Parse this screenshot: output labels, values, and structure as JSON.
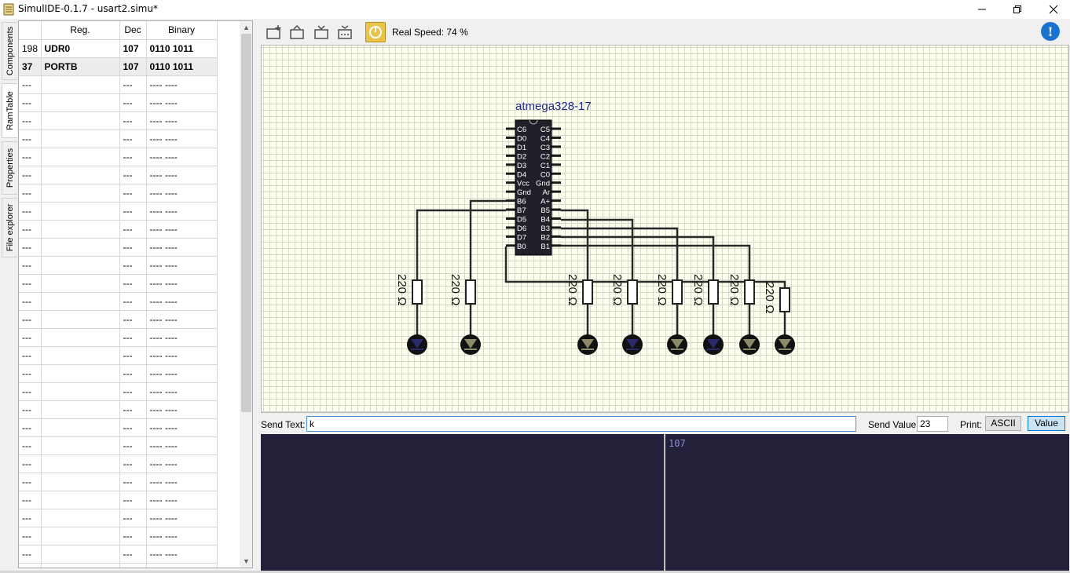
{
  "window": {
    "title": "SimulIDE-0.1.7  -  usart2.simu*"
  },
  "side_tabs": [
    "Components",
    "RamTable",
    "Properties",
    "File explorer"
  ],
  "ram_table": {
    "headers": [
      "",
      "Reg.",
      "Dec",
      "Binary"
    ],
    "rows": [
      [
        "198",
        "UDR0",
        "107",
        "0110 1011"
      ],
      [
        "37",
        "PORTB",
        "107",
        "0110 1011"
      ],
      [
        "---",
        "",
        "---",
        "---- ----"
      ],
      [
        "---",
        "",
        "---",
        "---- ----"
      ],
      [
        "---",
        "",
        "---",
        "---- ----"
      ],
      [
        "---",
        "",
        "---",
        "---- ----"
      ],
      [
        "---",
        "",
        "---",
        "---- ----"
      ],
      [
        "---",
        "",
        "---",
        "---- ----"
      ],
      [
        "---",
        "",
        "---",
        "---- ----"
      ],
      [
        "---",
        "",
        "---",
        "---- ----"
      ],
      [
        "---",
        "",
        "---",
        "---- ----"
      ],
      [
        "---",
        "",
        "---",
        "---- ----"
      ],
      [
        "---",
        "",
        "---",
        "---- ----"
      ],
      [
        "---",
        "",
        "---",
        "---- ----"
      ],
      [
        "---",
        "",
        "---",
        "---- ----"
      ],
      [
        "---",
        "",
        "---",
        "---- ----"
      ],
      [
        "---",
        "",
        "---",
        "---- ----"
      ],
      [
        "---",
        "",
        "---",
        "---- ----"
      ],
      [
        "---",
        "",
        "---",
        "---- ----"
      ],
      [
        "---",
        "",
        "---",
        "---- ----"
      ],
      [
        "---",
        "",
        "---",
        "---- ----"
      ],
      [
        "---",
        "",
        "---",
        "---- ----"
      ],
      [
        "---",
        "",
        "---",
        "---- ----"
      ],
      [
        "---",
        "",
        "---",
        "---- ----"
      ],
      [
        "---",
        "",
        "---",
        "---- ----"
      ],
      [
        "---",
        "",
        "---",
        "---- ----"
      ],
      [
        "---",
        "",
        "---",
        "---- ----"
      ],
      [
        "---",
        "",
        "---",
        "---- ----"
      ],
      [
        "---",
        "",
        "---",
        "---- ----"
      ],
      [
        "---",
        "",
        "---",
        "---- ----"
      ]
    ]
  },
  "toolbar": {
    "icons": [
      "new-circuit-icon",
      "open-circuit-icon",
      "save-circuit-icon",
      "save-as-icon"
    ],
    "speed_text": "Real Speed: 74 %"
  },
  "circuit": {
    "chip_label": "atmega328-17",
    "left_pins": [
      "C6",
      "D0",
      "D1",
      "D2",
      "D3",
      "D4",
      "Vcc",
      "Gnd",
      "B6",
      "B7",
      "D5",
      "D6",
      "D7",
      "B0"
    ],
    "right_pins": [
      "C5",
      "C4",
      "C3",
      "C2",
      "C1",
      "C0",
      "Gnd",
      "Ar",
      "A+",
      "B5",
      "B4",
      "B3",
      "B2",
      "B1"
    ],
    "resistor_label": "220 Ω",
    "led_states": [
      "on",
      "off",
      "off",
      "on",
      "off",
      "on",
      "off",
      "off"
    ]
  },
  "serial": {
    "send_text_label": "Send Text:",
    "send_text_value": "k",
    "send_value_label": "Send Value:",
    "send_value_value": "23",
    "print_label": "Print:",
    "ascii_label": "ASCII",
    "value_label": "Value",
    "received": "107"
  },
  "colors": {
    "grid_bg": "#fffff0",
    "chip": "#20202a",
    "led_on": "#2a2a6a",
    "led_off": "#8a8a6a",
    "serial_bg": "#23213a"
  }
}
